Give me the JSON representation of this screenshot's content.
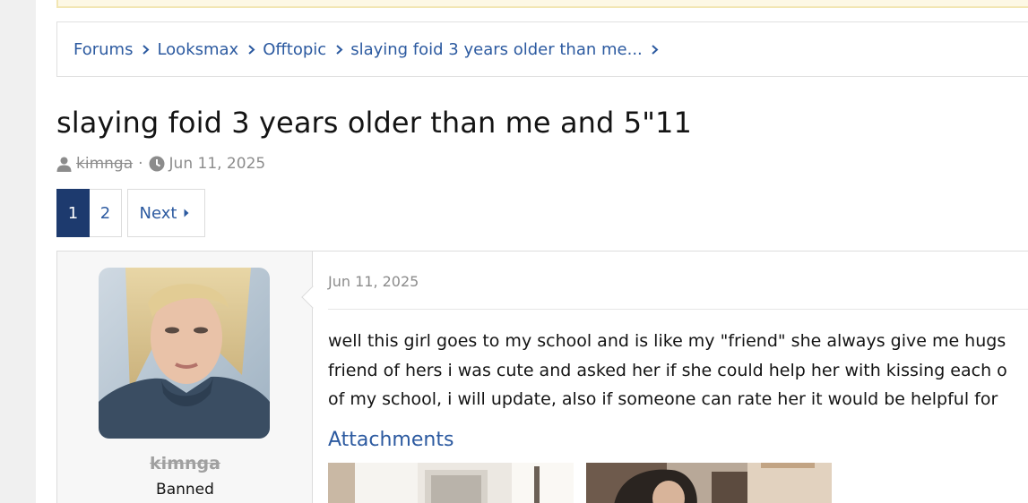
{
  "breadcrumb": {
    "items": [
      "Forums",
      "Looksmax",
      "Offtopic",
      "slaying foid 3 years older than me..."
    ]
  },
  "thread": {
    "title": "slaying foid 3 years older than me and 5\"11",
    "author": "kimnga",
    "separator": "·",
    "date": "Jun 11, 2025"
  },
  "pagination": {
    "pages": [
      "1",
      "2"
    ],
    "current": "1",
    "next_label": "Next"
  },
  "post": {
    "username": "kimnga",
    "user_title": "Banned",
    "date": "Jun 11, 2025",
    "body_lines": [
      "well this girl goes to my school and is like my \"friend\" she always give me hugs",
      "friend of hers i was cute and asked her if she could help her with kissing each o",
      "of my school, i will update, also if someone can rate her it would be helpful for"
    ],
    "attachments_label": "Attachments"
  },
  "icons": {
    "chevron": "chevron-right-icon",
    "user": "user-icon",
    "clock": "clock-icon",
    "next_arrow": "caret-right-icon"
  },
  "colors": {
    "link": "#2c5aa0",
    "active_page": "#1d3a6e",
    "muted": "#8c8c8c"
  }
}
